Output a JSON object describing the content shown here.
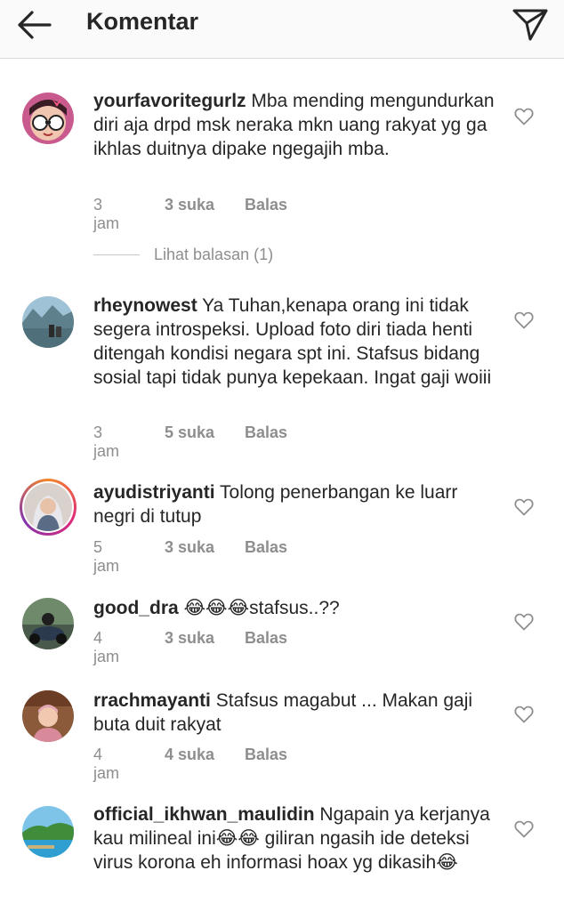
{
  "header": {
    "title": "Komentar",
    "back_icon": "arrow-left-icon",
    "send_icon": "paper-plane-icon"
  },
  "comments": [
    {
      "username": "yourfavoritegurlz",
      "text": "Mba mending mengundurkan diri aja drpd msk neraka mkn uang rakyat yg ga ikhlas duitnya dipake ngegajih mba.",
      "time": "3 jam",
      "likes": "3 suka",
      "reply": "Balas"
    },
    {
      "username": "rheynowest",
      "text": "Ya Tuhan,kenapa orang ini tidak segera introspeksi. Upload foto diri tiada henti ditengah kondisi negara spt ini. Stafsus bidang sosial tapi tidak punya kepekaan. Ingat gaji woiii",
      "time": "3 jam",
      "likes": "5 suka",
      "reply": "Balas"
    },
    {
      "username": "ayudistriyanti",
      "text": "Tolong penerbangan ke luarr negri di tutup",
      "time": "5 jam",
      "likes": "3 suka",
      "reply": "Balas"
    },
    {
      "username": "good_dra",
      "text": "😂😂😂stafsus..??",
      "time": "4 jam",
      "likes": "3 suka",
      "reply": "Balas"
    },
    {
      "username": "rrachmayanti",
      "text": "Stafsus magabut ... Makan gaji buta duit rakyat",
      "time": "4 jam",
      "likes": "4 suka",
      "reply": "Balas"
    },
    {
      "username": "official_ikhwan_maulidin",
      "text": "Ngapain ya kerjanya kau milineal ini😂😂 giliran ngasih ide deteksi virus korona eh informasi hoax yg dikasih😂",
      "time": "",
      "likes": "",
      "reply": ""
    }
  ],
  "view_replies": "Lihat balasan (1)",
  "colors": {
    "text": "#262626",
    "muted": "#8e8e8e",
    "divider": "#dbdbdb"
  }
}
